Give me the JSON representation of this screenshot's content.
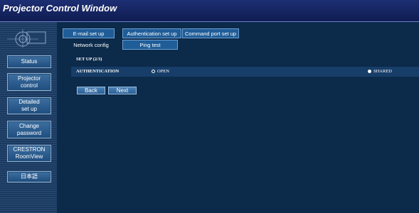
{
  "window": {
    "title": "Projector Control Window"
  },
  "sidebar": {
    "items": [
      {
        "label": "Status"
      },
      {
        "label": "Projector\ncontrol"
      },
      {
        "label": "Detailed\nset up"
      },
      {
        "label": "Change\npassword"
      },
      {
        "label": "CRESTRON\nRoomView"
      },
      {
        "label": "日本語"
      }
    ]
  },
  "tabs": {
    "row1": [
      {
        "label": "E-mail set up"
      },
      {
        "label": "Authentication set up"
      },
      {
        "label": "Command port set up"
      }
    ],
    "row2": [
      {
        "label": "Network config"
      },
      {
        "label": "Ping test"
      }
    ]
  },
  "form": {
    "section_title": "SET UP (2/3)",
    "authentication": {
      "label": "AUTHENTICATION",
      "options": [
        {
          "label": "OPEN",
          "selected": false
        },
        {
          "label": "SHARED",
          "selected": true
        }
      ]
    },
    "back_label": "Back",
    "next_label": "Next"
  },
  "colors": {
    "background": "#0c2a4a",
    "titlebar": "#1d2e73",
    "button": "#2b5f95"
  }
}
